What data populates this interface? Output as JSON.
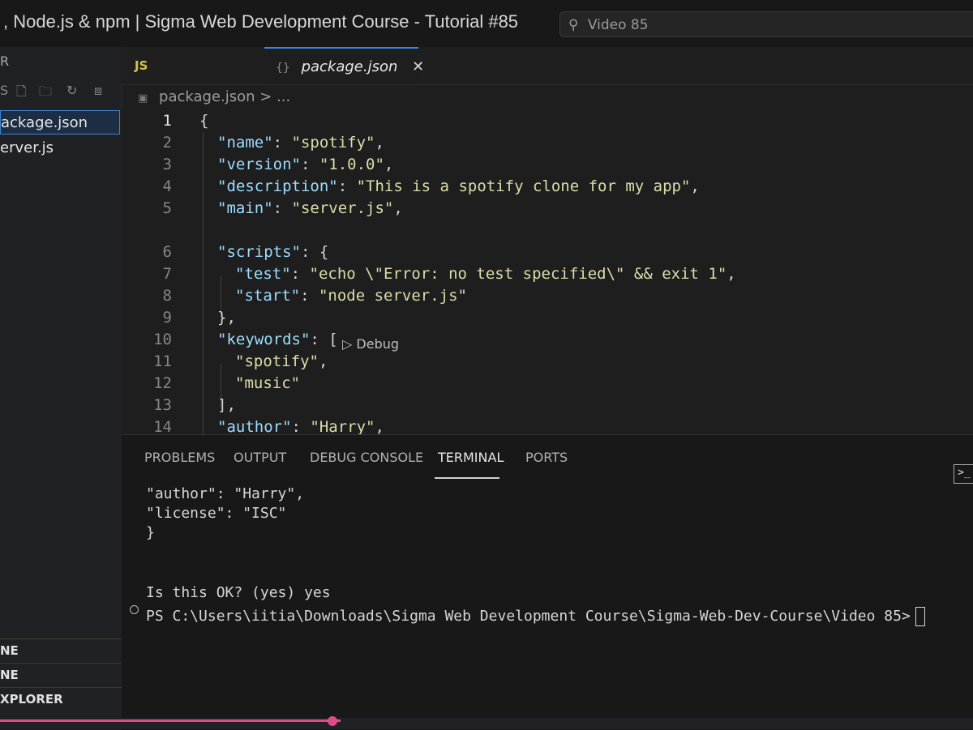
{
  "window": {
    "title": ", Node.js & npm | Sigma Web Development Course - Tutorial #85",
    "search_text": "Video 85"
  },
  "sidebar": {
    "header": "R",
    "files": [
      {
        "label": "ackage.json",
        "active": true
      },
      {
        "label": "erver.js",
        "active": false
      }
    ],
    "sections": [
      "NE",
      "NE",
      "XPLORER"
    ]
  },
  "tabs": [
    {
      "badge": "JS",
      "label": "",
      "active": false
    },
    {
      "badge": "{}",
      "label": "package.json",
      "active": true
    }
  ],
  "breadcrumb": {
    "file": "package.json",
    "rest": "> ..."
  },
  "codelens": {
    "label": "Debug"
  },
  "editor": {
    "lines": [
      {
        "n": "1",
        "text": "{"
      },
      {
        "n": "2",
        "key": "\"name\"",
        "val": "\"spotify\"",
        "tail": ","
      },
      {
        "n": "3",
        "key": "\"version\"",
        "val": "\"1.0.0\"",
        "tail": ","
      },
      {
        "n": "4",
        "key": "\"description\"",
        "val": "\"This is a spotify clone for my app\"",
        "tail": ","
      },
      {
        "n": "5",
        "key": "\"main\"",
        "val": "\"server.js\"",
        "tail": ","
      },
      {
        "n": "6",
        "key": "\"scripts\"",
        "tail": ": {"
      },
      {
        "n": "7",
        "key": "\"test\"",
        "val": "\"echo \\\"Error: no test specified\\\" && exit 1\"",
        "tail": ","
      },
      {
        "n": "8",
        "key": "\"start\"",
        "val": "\"node server.js\"",
        "tail": ""
      },
      {
        "n": "9",
        "text": "},"
      },
      {
        "n": "10",
        "key": "\"keywords\"",
        "tail": ": ["
      },
      {
        "n": "11",
        "val": "\"spotify\"",
        "tail": ","
      },
      {
        "n": "12",
        "val": "\"music\"",
        "tail": ""
      },
      {
        "n": "13",
        "text": "],"
      },
      {
        "n": "14",
        "key": "\"author\"",
        "val": "\"Harry\"",
        "tail": ","
      }
    ]
  },
  "panel": {
    "tabs": [
      "PROBLEMS",
      "OUTPUT",
      "DEBUG CONSOLE",
      "TERMINAL",
      "PORTS"
    ],
    "active": "TERMINAL",
    "terminal_icon": ">_",
    "terminal_lines": [
      "  \"author\": \"Harry\",",
      "  \"license\": \"ISC\"",
      "}",
      "",
      "",
      "Is this OK? (yes) yes",
      "PS C:\\Users\\iitia\\Downloads\\Sigma Web Development Course\\Sigma-Web-Dev-Course\\Video 85>"
    ]
  }
}
